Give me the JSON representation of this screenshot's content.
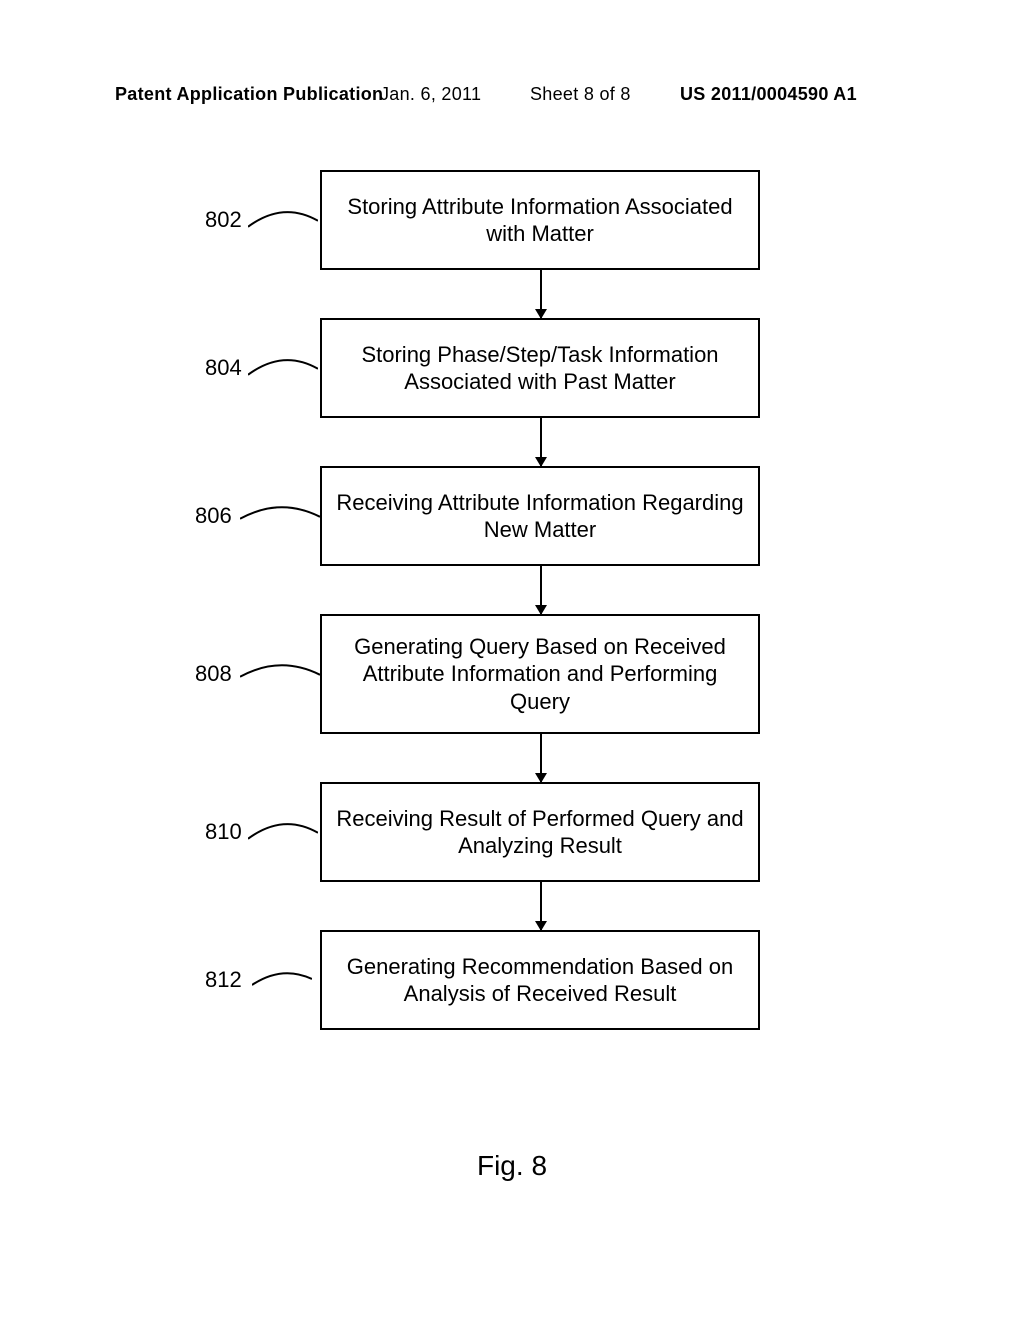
{
  "header": {
    "publication": "Patent Application Publication",
    "date": "Jan. 6, 2011",
    "sheet": "Sheet 8 of 8",
    "docnum": "US 2011/0004590 A1"
  },
  "steps": [
    {
      "ref": "802",
      "text": "Storing Attribute Information Associated with Matter"
    },
    {
      "ref": "804",
      "text": "Storing Phase/Step/Task Information Associated with Past Matter"
    },
    {
      "ref": "806",
      "text": "Receiving Attribute Information Regarding New Matter"
    },
    {
      "ref": "808",
      "text": "Generating Query Based on Received Attribute Information and Performing Query"
    },
    {
      "ref": "810",
      "text": "Receiving Result of Performed Query and Analyzing Result"
    },
    {
      "ref": "812",
      "text": "Generating Recommendation Based on Analysis of Received Result"
    }
  ],
  "figure_label": "Fig. 8"
}
